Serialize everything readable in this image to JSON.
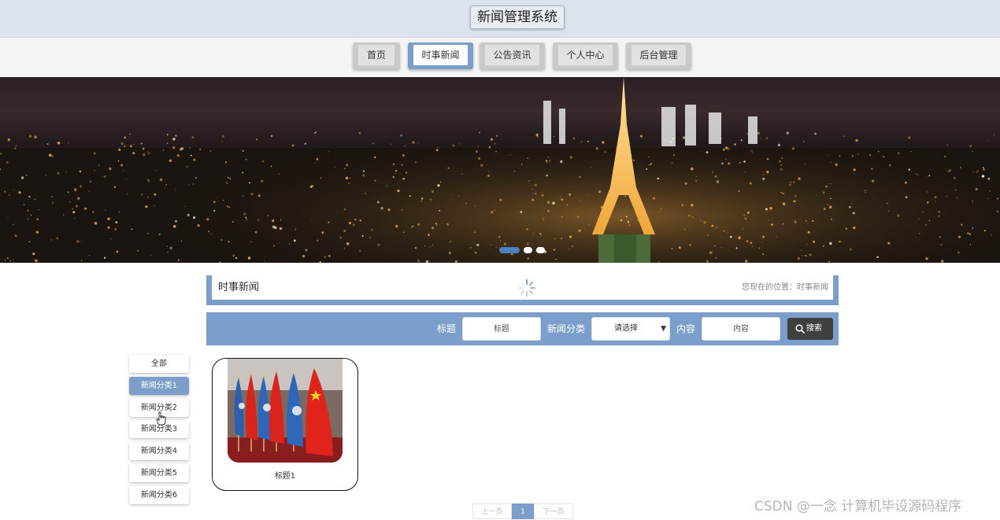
{
  "header": {
    "title": "新闻管理系统"
  },
  "nav": {
    "items": [
      {
        "label": "首页",
        "active": false
      },
      {
        "label": "时事新闻",
        "active": true
      },
      {
        "label": "公告资讯",
        "active": false
      },
      {
        "label": "个人中心",
        "active": false
      },
      {
        "label": "后台管理",
        "active": false
      }
    ]
  },
  "banner": {
    "slide_count": 3,
    "active_slide": 1
  },
  "location": {
    "title": "时事新闻",
    "breadcrumb": "您现在的位置：时事新闻"
  },
  "search": {
    "title_label": "标题",
    "title_placeholder": "标题",
    "category_label": "新闻分类",
    "category_selected": "请选择",
    "content_label": "内容",
    "content_placeholder": "内容",
    "button_label": "搜索"
  },
  "categories": {
    "items": [
      "全部",
      "新闻分类1",
      "新闻分类2",
      "新闻分类3",
      "新闻分类4",
      "新闻分类5",
      "新闻分类6"
    ],
    "active_index": 1
  },
  "news": {
    "items": [
      {
        "title": "标题1"
      }
    ]
  },
  "pagination": {
    "prev": "上一页",
    "current": "1",
    "next": "下一页"
  },
  "watermark": "CSDN @一念 计算机毕设源码程序",
  "colors": {
    "accent": "#7b9fca",
    "header_bg": "#dde3ec",
    "button_dark": "#3f3f3f"
  }
}
